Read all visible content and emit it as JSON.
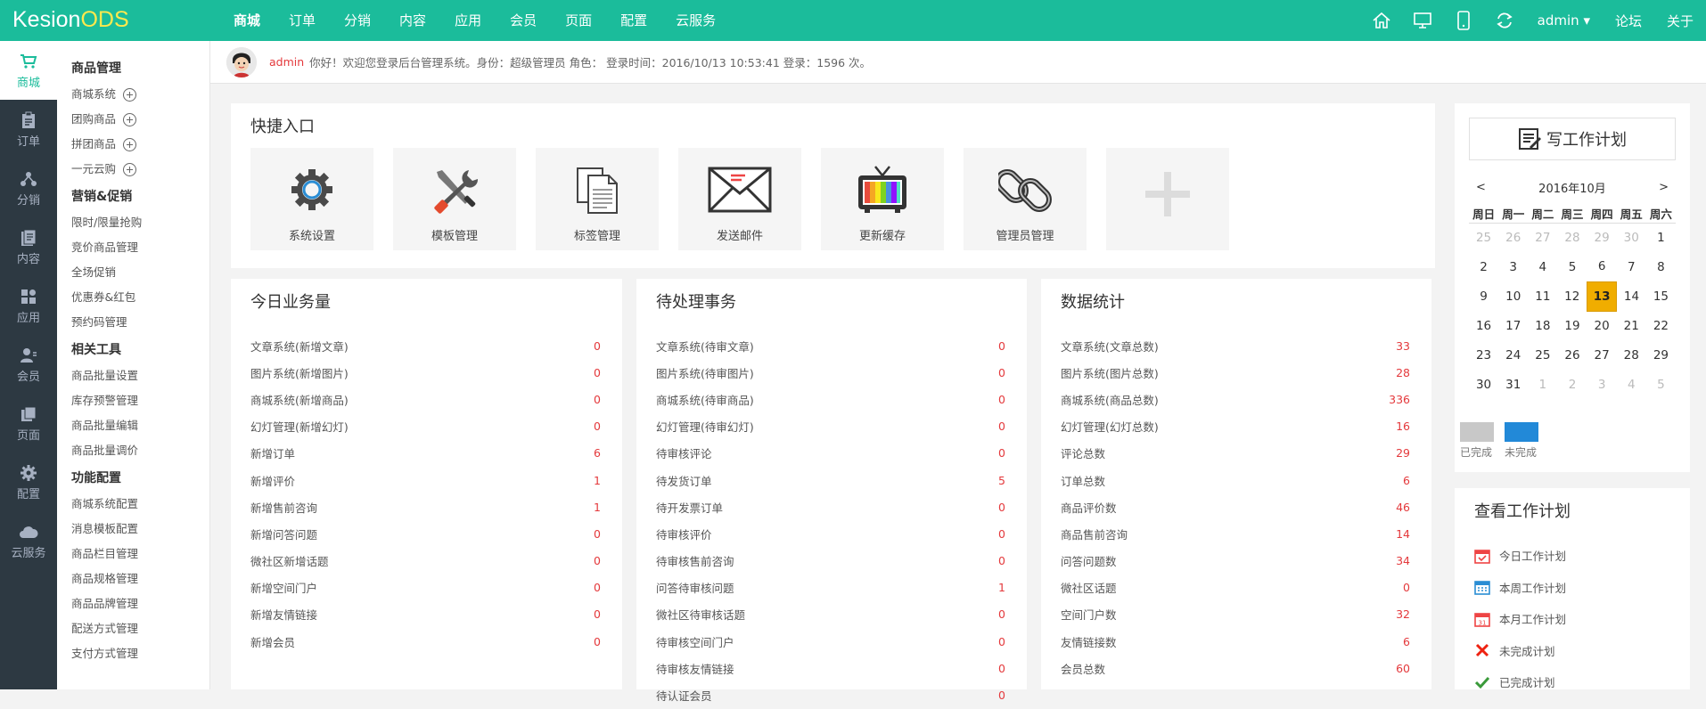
{
  "brand": {
    "logo_a": "Kesion",
    "logo_b": "ODS"
  },
  "topnav": [
    "商城",
    "订单",
    "分销",
    "内容",
    "应用",
    "会员",
    "页面",
    "配置",
    "云服务"
  ],
  "topright": {
    "user": "admin ▾",
    "forum": "论坛",
    "about": "关于"
  },
  "rail": [
    {
      "label": "商城",
      "icon": "cart-icon"
    },
    {
      "label": "订单",
      "icon": "clipboard-icon"
    },
    {
      "label": "分销",
      "icon": "share-icon"
    },
    {
      "label": "内容",
      "icon": "document-icon"
    },
    {
      "label": "应用",
      "icon": "apps-icon"
    },
    {
      "label": "会员",
      "icon": "user-icon"
    },
    {
      "label": "页面",
      "icon": "pages-icon"
    },
    {
      "label": "配置",
      "icon": "gear-icon"
    },
    {
      "label": "云服务",
      "icon": "cloud-icon"
    }
  ],
  "submenu": {
    "g1": "商品管理",
    "g1_items": [
      "商城系统",
      "团购商品",
      "拼团商品",
      "一元云购"
    ],
    "g2": "营销&促销",
    "g2_items": [
      "限时/限量抢购",
      "竞价商品管理",
      "全场促销",
      "优惠券&红包",
      "预约码管理"
    ],
    "g3": "相关工具",
    "g3_items": [
      "商品批量设置",
      "库存预警管理",
      "商品批量编辑",
      "商品批量调价"
    ],
    "g4": "功能配置",
    "g4_items": [
      "商城系统配置",
      "消息模板配置",
      "商品栏目管理",
      "商品规格管理",
      "商品品牌管理",
      "配送方式管理",
      "支付方式管理"
    ]
  },
  "welcome": {
    "user": "admin",
    "text": "你好！欢迎您登录后台管理系统。身份：超级管理员 角色： 登录时间：2016/10/13 10:53:41 登录：1596 次。"
  },
  "quick": {
    "title": "快捷入口",
    "items": [
      "系统设置",
      "模板管理",
      "标签管理",
      "发送邮件",
      "更新缓存",
      "管理员管理"
    ]
  },
  "today": {
    "title": "今日业务量",
    "rows": [
      {
        "label": "文章系统(新增文章)",
        "value": "0"
      },
      {
        "label": "图片系统(新增图片)",
        "value": "0"
      },
      {
        "label": "商城系统(新增商品)",
        "value": "0"
      },
      {
        "label": "幻灯管理(新增幻灯)",
        "value": "0"
      },
      {
        "label": "新增订单",
        "value": "6"
      },
      {
        "label": "新增评价",
        "value": "1"
      },
      {
        "label": "新增售前咨询",
        "value": "1"
      },
      {
        "label": "新增问答问题",
        "value": "0"
      },
      {
        "label": "微社区新增话题",
        "value": "0"
      },
      {
        "label": "新增空间门户",
        "value": "0"
      },
      {
        "label": "新增友情链接",
        "value": "0"
      },
      {
        "label": "新增会员",
        "value": "0"
      }
    ]
  },
  "pending": {
    "title": "待处理事务",
    "rows": [
      {
        "label": "文章系统(待审文章)",
        "value": "0"
      },
      {
        "label": "图片系统(待审图片)",
        "value": "0"
      },
      {
        "label": "商城系统(待审商品)",
        "value": "0"
      },
      {
        "label": "幻灯管理(待审幻灯)",
        "value": "0"
      },
      {
        "label": "待审核评论",
        "value": "0"
      },
      {
        "label": "待发货订单",
        "value": "5"
      },
      {
        "label": "待开发票订单",
        "value": "0"
      },
      {
        "label": "待审核评价",
        "value": "0"
      },
      {
        "label": "待审核售前咨询",
        "value": "0"
      },
      {
        "label": "问答待审核问题",
        "value": "1"
      },
      {
        "label": "微社区待审核话题",
        "value": "0"
      },
      {
        "label": "待审核空间门户",
        "value": "0"
      },
      {
        "label": "待审核友情链接",
        "value": "0"
      },
      {
        "label": "待认证会员",
        "value": "0"
      }
    ]
  },
  "stats": {
    "title": "数据统计",
    "rows": [
      {
        "label": "文章系统(文章总数)",
        "value": "33"
      },
      {
        "label": "图片系统(图片总数)",
        "value": "28"
      },
      {
        "label": "商城系统(商品总数)",
        "value": "336"
      },
      {
        "label": "幻灯管理(幻灯总数)",
        "value": "16"
      },
      {
        "label": "评论总数",
        "value": "29"
      },
      {
        "label": "订单总数",
        "value": "6"
      },
      {
        "label": "商品评价数",
        "value": "46"
      },
      {
        "label": "商品售前咨询",
        "value": "14"
      },
      {
        "label": "问答问题数",
        "value": "34"
      },
      {
        "label": "微社区话题",
        "value": "0"
      },
      {
        "label": "空间门户数",
        "value": "32"
      },
      {
        "label": "友情链接数",
        "value": "6"
      },
      {
        "label": "会员总数",
        "value": "60"
      }
    ]
  },
  "plan": {
    "write": "写工作计划",
    "month": "2016年10月",
    "prev": "<",
    "next": ">",
    "weekdays": [
      "周日",
      "周一",
      "周二",
      "周三",
      "周四",
      "周五",
      "周六"
    ],
    "weeks": [
      [
        "25",
        "26",
        "27",
        "28",
        "29",
        "30",
        "1"
      ],
      [
        "2",
        "3",
        "4",
        "5",
        "6",
        "7",
        "8"
      ],
      [
        "9",
        "10",
        "11",
        "12",
        "13",
        "14",
        "15"
      ],
      [
        "16",
        "17",
        "18",
        "19",
        "20",
        "21",
        "22"
      ],
      [
        "23",
        "24",
        "25",
        "26",
        "27",
        "28",
        "29"
      ],
      [
        "30",
        "31",
        "1",
        "2",
        "3",
        "4",
        "5"
      ]
    ],
    "today": "13",
    "legend_done": "已完成",
    "legend_todo": "未完成",
    "color_done": "#c8c8c8",
    "color_todo": "#2289d8"
  },
  "viewplan": {
    "title": "查看工作计划",
    "items": [
      "今日工作计划",
      "本周工作计划",
      "本月工作计划",
      "未完成计划",
      "已完成计划"
    ]
  },
  "colors": {
    "accent": "#1bbc9b",
    "rail": "#2d3942",
    "value_red": "#e4393c",
    "today": "#f0ad00"
  }
}
